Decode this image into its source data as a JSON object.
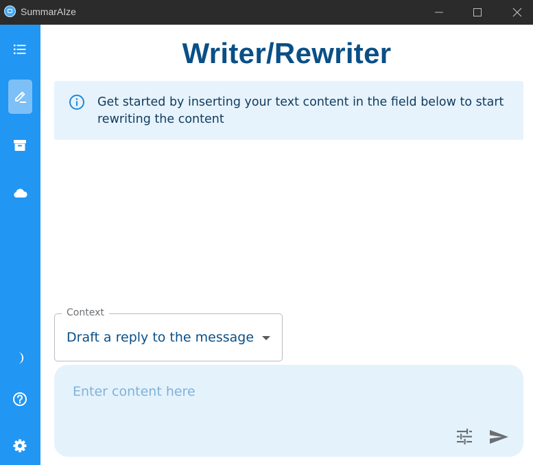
{
  "window": {
    "title": "SummarAIze",
    "icon": "app-logo-icon",
    "controls": [
      "minimize-icon",
      "maximize-icon",
      "close-icon"
    ]
  },
  "sidebar": {
    "background": "#2196f3",
    "items": [
      {
        "icon": "list-icon",
        "active": false
      },
      {
        "icon": "edit-icon",
        "active": true
      },
      {
        "icon": "archive-icon",
        "active": false
      },
      {
        "icon": "cloud-icon",
        "active": false
      },
      {
        "icon": "dark-mode-icon",
        "active": false
      },
      {
        "icon": "help-icon",
        "active": false
      },
      {
        "icon": "settings-icon",
        "active": false
      }
    ]
  },
  "main": {
    "title": "Writer/Rewriter",
    "info": {
      "icon": "info-icon",
      "text": "Get started by inserting your text content in the field below to start rewriting the content"
    },
    "context": {
      "label": "Context",
      "value": "Draft a reply to the message"
    },
    "composer": {
      "placeholder": "Enter content here",
      "tune_icon": "tune-icon",
      "send_icon": "send-icon"
    }
  },
  "colors": {
    "accent": "#2196f3",
    "title": "#0a4f86",
    "info_bg": "#e6f3fc",
    "composer_bg": "#e4f2fc"
  }
}
